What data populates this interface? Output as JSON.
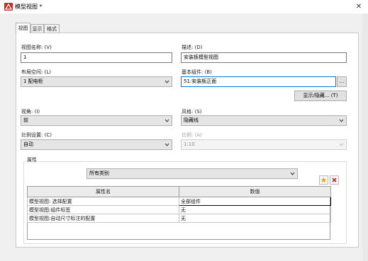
{
  "window": {
    "title": "模型视图 *"
  },
  "tabs": [
    {
      "label": "视图",
      "active": true
    },
    {
      "label": "显示",
      "active": false
    },
    {
      "label": "格式",
      "active": false
    }
  ],
  "form": {
    "view_name": {
      "label": "视图名称: (V)",
      "value": "1"
    },
    "description": {
      "label": "描述: (D)",
      "value": "安装板模型视图"
    },
    "layout_space": {
      "label": "布局空间: (L)",
      "value": "1 配电柜"
    },
    "base_component": {
      "label": "基本组件: (B)",
      "value": "51:安装板正面",
      "browse": "..."
    },
    "show_hide_button": "显示/隐藏... (T)",
    "viewing_angle": {
      "label": "视角: (I)",
      "value": "前"
    },
    "style": {
      "label": "风格: (S)",
      "value": "隐藏线"
    },
    "scale_setting": {
      "label": "比例设置: (C)",
      "value": "自动"
    },
    "scale": {
      "label": "比例: (A)",
      "value": "1:10"
    }
  },
  "properties": {
    "group_title": "属性",
    "filter": "所有类别",
    "columns": [
      "属性名",
      "数值"
    ],
    "rows": [
      {
        "name": "模型视图: 选择配置",
        "value": "全部组件"
      },
      {
        "name": "模型视图:组件标签",
        "value": "无"
      },
      {
        "name": "模型视图:自动尺寸标注的配置",
        "value": "无"
      }
    ]
  },
  "colors": {
    "app_icon": "#d02828",
    "delete": "#c0302b",
    "new_star": "#e8a317",
    "focus_border": "#0078d7"
  }
}
